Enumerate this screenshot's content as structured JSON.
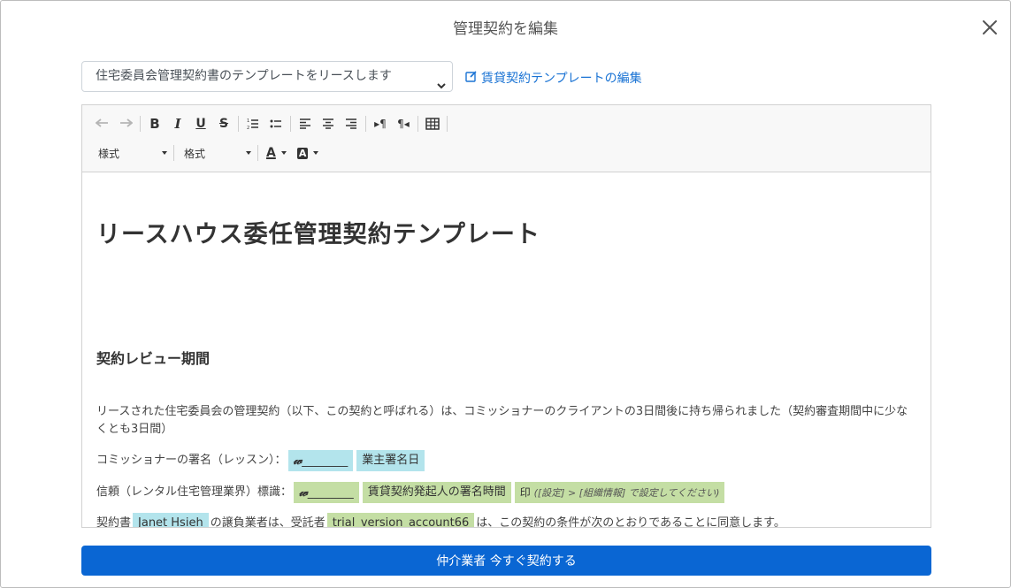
{
  "modal": {
    "title": "管理契約を編集"
  },
  "template_select": {
    "selected": "住宅委員会管理契約書のテンプレートをリースします"
  },
  "edit_link": {
    "label": "賃貸契約テンプレートの編集"
  },
  "toolbar": {
    "style_label": "様式",
    "format_label": "格式",
    "font_color_label": "A",
    "bg_color_label": "A"
  },
  "document": {
    "title": "リースハウス委任管理契約テンプレート",
    "section_title": "契約レビュー期間",
    "paragraph1": "リースされた住宅委員会の管理契約（以下、この契約と呼ばれる）は、コミッショナーのクライアントの3日間後に持ち帰られました（契約審査期間中に少なくとも3日間）",
    "line2_text": "コミッショナーの署名（レッスン）：",
    "line2_sig": "________",
    "line2_tag": "業主署名日",
    "line3_text": "信頼（レンタル住宅管理業界）標識：",
    "line3_sig": "________",
    "line3_tag1": "賃貸契約発起人の署名時間",
    "line3_tag2_prefix": "印",
    "line3_tag2_hint": "([設定] > [組織情報] で設定してください)",
    "line4_prefix": "契約書",
    "line4_name": "Janet Hsieh",
    "line4_mid": "の譲負業者は、受託者",
    "line4_account": "trial_version_account66",
    "line4_suffix": "は、この契約の条件が次のとおりであることに同意します。"
  },
  "submit": {
    "label": "仲介業者 今すぐ契約する"
  },
  "colors": {
    "primary": "#0a66d3",
    "tag_blue": "#b3e4ec",
    "tag_green": "#c4dea4",
    "link": "#1a73d4"
  }
}
